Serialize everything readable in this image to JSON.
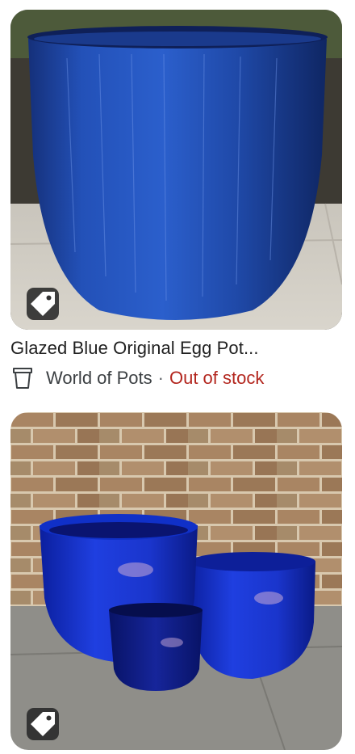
{
  "results": [
    {
      "title": "Glazed Blue Original Egg Pot...",
      "merchant": "World of Pots",
      "separator": "·",
      "stock_status": "Out of stock",
      "stock_color": "#b3261e",
      "image_subject": "large blue glazed egg pot",
      "badge_icon": "tag-icon"
    },
    {
      "image_subject": "set of three cobalt blue glazed pots",
      "badge_icon": "tag-icon"
    }
  ]
}
